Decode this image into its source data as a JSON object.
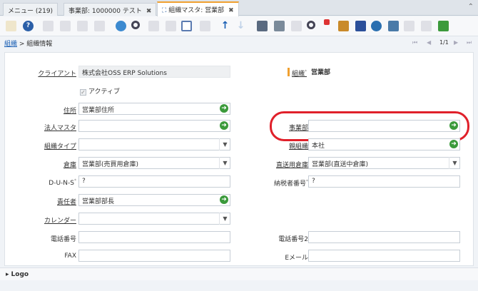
{
  "tabs": [
    {
      "label": "メニュー (219)"
    },
    {
      "label": "事業部: 1000000 テスト",
      "close": "✖"
    },
    {
      "label": "組織マスタ: 営業部",
      "close": "✖"
    }
  ],
  "tabs_overflow": "⌃",
  "toolbar": {
    "icons": [
      "undo-icon",
      "help-icon",
      "new-icon",
      "copy-icon",
      "save-icon",
      "save-new-icon",
      "refresh-icon",
      "find-icon",
      "attachment-icon",
      "chat-icon",
      "grid-toggle-icon",
      "history-icon",
      "parent-icon",
      "detail-icon",
      "report-icon",
      "print-icon",
      "print-preview-icon",
      "export-icon",
      "zoom-across-icon",
      "archive-icon",
      "requests-icon",
      "workflow-icon",
      "product-info-icon",
      "lock-icon",
      "customize-icon",
      "close-window-icon"
    ],
    "accent": "#1a5fb4"
  },
  "breadcrumb": {
    "link": "組織",
    "sep": " > ",
    "current": "組織情報"
  },
  "pager": {
    "first": "⏮",
    "prev": "◀",
    "text": "1/1",
    "next": "▶",
    "last": "⏭"
  },
  "form": {
    "client": {
      "label": "クライアント",
      "value": "株式会社OSS ERP Solutions"
    },
    "org": {
      "label": "組織",
      "value": "営業部"
    },
    "active": {
      "label": "アクティブ",
      "checked": true,
      "mark": "✓"
    },
    "address": {
      "label": "住所",
      "value": "営業部住所"
    },
    "legal_entity": {
      "label": "法人マスタ",
      "value": ""
    },
    "division": {
      "label": "事業部",
      "value": ""
    },
    "org_type": {
      "label": "組織タイプ",
      "value": ""
    },
    "parent_org": {
      "label": "親組織",
      "value": "本社"
    },
    "warehouse": {
      "label": "倉庫",
      "value": "営業部(売買用倉庫)"
    },
    "drop_ship_warehouse": {
      "label": "直送用倉庫",
      "value": "営業部(直送中倉庫)"
    },
    "duns": {
      "label": "D-U-N-S",
      "value": "?"
    },
    "tax_id": {
      "label": "納税者番号",
      "value": "?"
    },
    "supervisor": {
      "label": "責任者",
      "value": "営業部部長"
    },
    "calendar": {
      "label": "カレンダー",
      "value": ""
    },
    "phone": {
      "label": "電話番号",
      "value": ""
    },
    "phone2": {
      "label": "電話番号2",
      "value": ""
    },
    "fax": {
      "label": "FAX",
      "value": ""
    },
    "email": {
      "label": "Eメール",
      "value": ""
    }
  },
  "glyphs": {
    "go": "➜",
    "dropdown": "▼",
    "required": "*",
    "expand": "▸"
  },
  "logo_section": {
    "label": "Logo"
  },
  "colors": {
    "highlight": "#e0202a",
    "go": "#3b9a3b",
    "tab_accent": "#f0a030"
  }
}
